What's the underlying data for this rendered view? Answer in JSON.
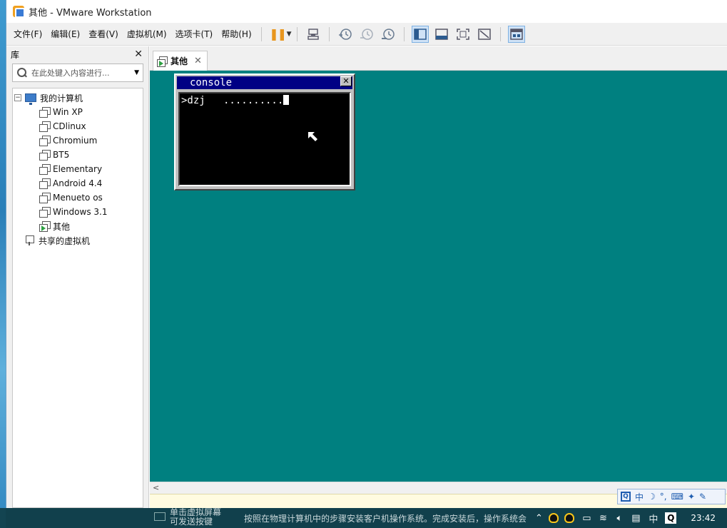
{
  "window": {
    "title": "其他 - VMware Workstation"
  },
  "menu": [
    "文件(F)",
    "编辑(E)",
    "查看(V)",
    "虚拟机(M)",
    "选项卡(T)",
    "帮助(H)"
  ],
  "toolbar": {
    "icons": [
      "pause-icon",
      "send-keys-icon",
      "snapshot-take-icon",
      "snapshot-revert-icon",
      "snapshot-manager-icon",
      "library-view-icon",
      "console-view-icon",
      "fullscreen-icon",
      "unity-icon",
      "thumbnail-icon"
    ]
  },
  "library": {
    "title": "库",
    "search_placeholder": "在此处键入内容进行...",
    "root_label": "我的计算机",
    "vms": [
      "Win XP",
      "CDlinux",
      "Chromium",
      "BT5",
      "Elementary",
      "Android 4.4",
      "Menueto os",
      "Windows 3.1",
      "其他"
    ],
    "active_vm": "其他",
    "shared_label": "共享的虚拟机"
  },
  "tab": {
    "label": "其他"
  },
  "guest": {
    "desktop_color": "#008080",
    "console_title": "console",
    "console_text": ">dzj   .........."
  },
  "status": {
    "hint_line1": "单击虚拟屏幕",
    "hint_line2": "可发送按键",
    "message": "按照在物理计算机中的步骤安装客户机操作系统。完成安装后，操作系统会"
  },
  "ime": {
    "mode": "中"
  },
  "tray": {
    "ime": "中",
    "time": "23:42"
  }
}
